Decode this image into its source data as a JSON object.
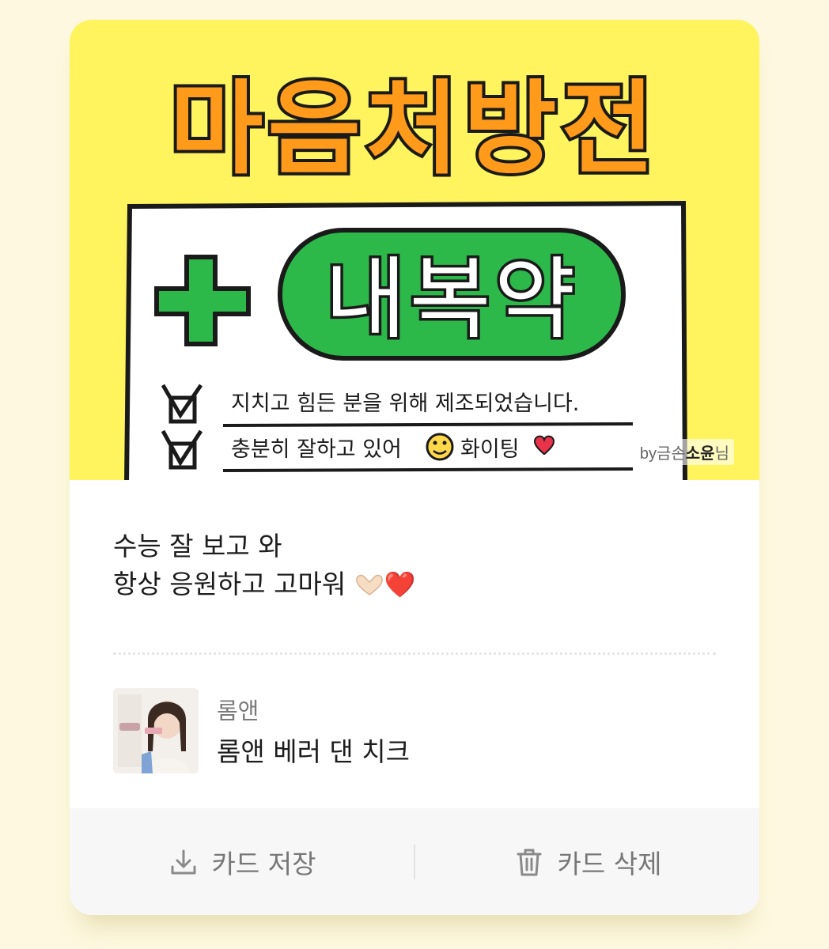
{
  "artwork": {
    "title": "마음처방전",
    "badge": "내복약",
    "line1": "지치고 힘든 분을 위해 제조되었습니다.",
    "line2_prefix": "충분히 잘하고 있어",
    "line2_suffix": "화이팅",
    "credit_by": "by",
    "credit_mid": "금손",
    "credit_name": "소윤",
    "credit_suffix": "님"
  },
  "message": {
    "line1": "수능 잘 보고 와",
    "line2": "항상 응원하고 고마워",
    "emoji_heart": "❤️"
  },
  "product": {
    "brand": "롬앤",
    "name": "롬앤 베러 댄 치크"
  },
  "footer": {
    "save_label": "카드 저장",
    "save_icon": "download-icon",
    "delete_label": "카드 삭제",
    "delete_icon": "trash-icon"
  },
  "colors": {
    "background": "#fdf8df",
    "art_yellow": "#fff35e",
    "title_orange": "#ff9a1a",
    "badge_green": "#2db84a",
    "heart_red": "#e01b2b"
  }
}
